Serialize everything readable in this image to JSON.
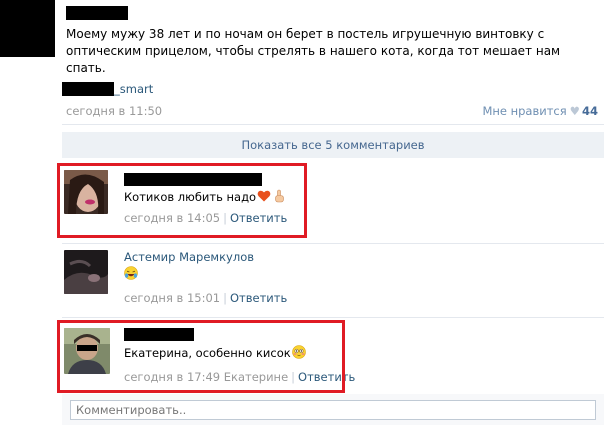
{
  "post": {
    "text": "Моему мужу 38 лет и по ночам он берет в постель игрушечную винтовку с оптическим прицелом, чтобы стрелять в нашего кота, когда тот мешает нам спать.",
    "source_suffix": "_smart",
    "time": "сегодня в 11:50",
    "like_label": "Мне нравится",
    "like_icon": "heart-icon",
    "like_count": "44"
  },
  "show_all_label": "Показать все 5 комментариев",
  "comments": [
    {
      "name": "",
      "text": "Котиков любить надо",
      "emoji": [
        "heart-emoji",
        "pointing-up-emoji"
      ],
      "time": "сегодня в 14:05",
      "reply_to": "",
      "reply_label": "Ответить",
      "highlighted": true
    },
    {
      "name": "Астемир Маремкулов",
      "text": "",
      "emoji": [
        "laughing-emoji"
      ],
      "time": "сегодня в 15:01",
      "reply_to": "",
      "reply_label": "Ответить",
      "highlighted": false
    },
    {
      "name": "",
      "text": "Екатерина, особенно кисок",
      "emoji": [
        "blushing-emoji"
      ],
      "time": "сегодня в 17:49",
      "reply_to": "Екатерине",
      "reply_label": "Ответить",
      "highlighted": true
    }
  ],
  "composer": {
    "placeholder": "Комментировать.."
  },
  "colors": {
    "link": "#2b587a",
    "muted": "#999999",
    "bar_bg": "#edf1f5",
    "highlight": "#e01b24"
  }
}
